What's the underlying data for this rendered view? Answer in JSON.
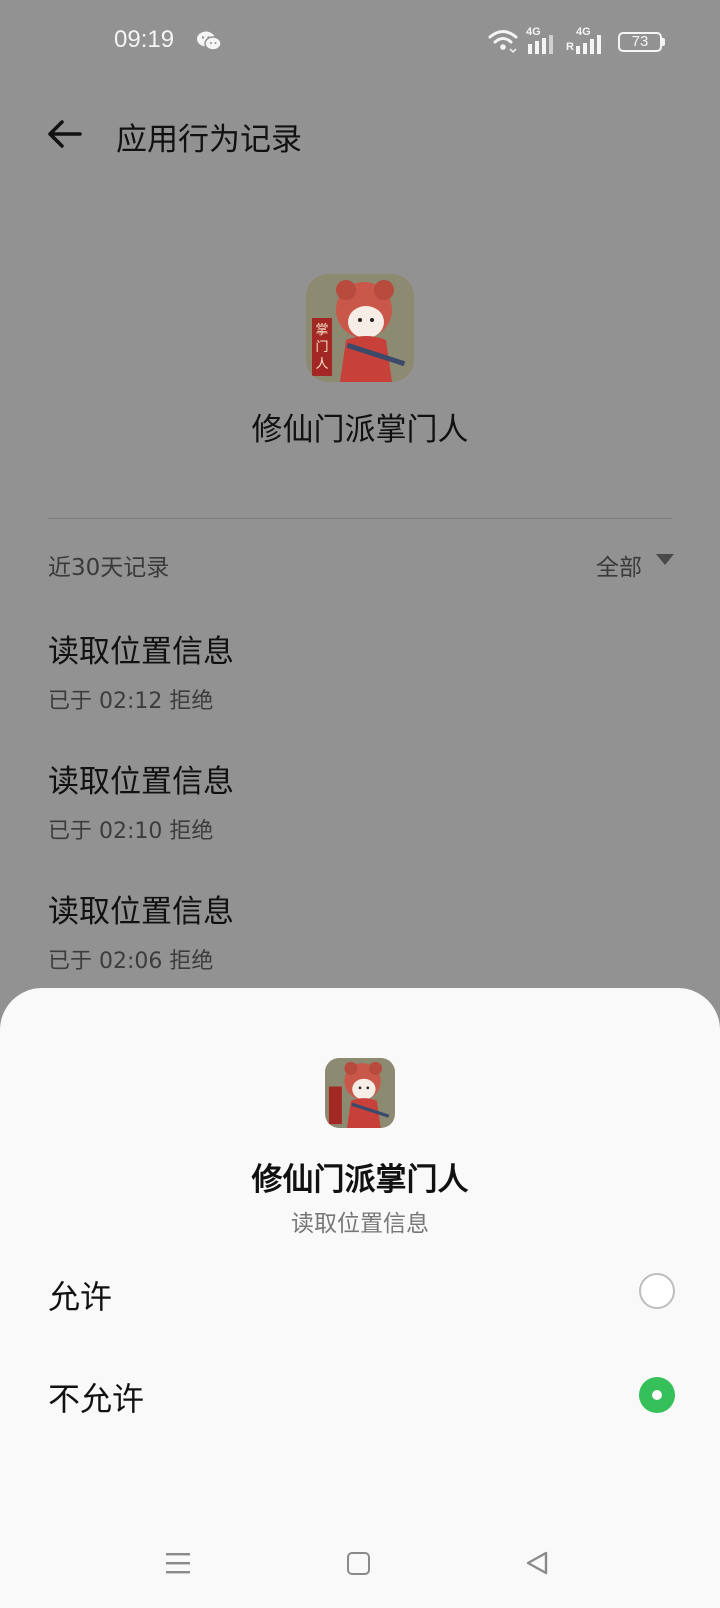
{
  "status_bar": {
    "time": "09:19",
    "network_1": "4G",
    "network_2": "4G",
    "roaming_mark": "R",
    "battery": "73",
    "icons": [
      "wechat-icon",
      "wifi-icon",
      "signal-icon",
      "battery-icon"
    ]
  },
  "header": {
    "title": "应用行为记录",
    "back_icon": "arrow-left-icon"
  },
  "app": {
    "name": "修仙门派掌门人",
    "icon_text": "掌门人"
  },
  "records": {
    "section_label": "近30天记录",
    "filter_label": "全部",
    "items": [
      {
        "title": "读取位置信息",
        "detail": "已于 02:12 拒绝"
      },
      {
        "title": "读取位置信息",
        "detail": "已于 02:10 拒绝"
      },
      {
        "title": "读取位置信息",
        "detail": "已于 02:06 拒绝"
      }
    ]
  },
  "sheet": {
    "app_name": "修仙门派掌门人",
    "permission": "读取位置信息",
    "options": [
      {
        "label": "允许",
        "selected": false
      },
      {
        "label": "不允许",
        "selected": true
      }
    ]
  },
  "colors": {
    "accent_green": "#35c05a",
    "scrim": "#929292",
    "sheet_bg": "#f9f9f9"
  },
  "nav": {
    "icons": [
      "menu-icon",
      "home-icon",
      "back-icon"
    ]
  }
}
